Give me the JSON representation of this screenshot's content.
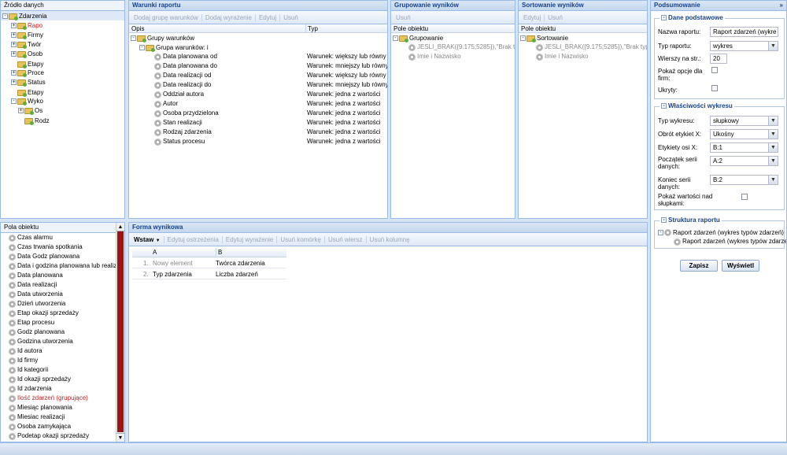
{
  "source_panel": {
    "title": "Źródło danych",
    "root": "Zdarzenia",
    "items": [
      {
        "label": "Rapo",
        "style": "red",
        "toggle": "+"
      },
      {
        "label": "Firmy",
        "style": "",
        "toggle": "+"
      },
      {
        "label": "Twór",
        "style": "",
        "toggle": "+"
      },
      {
        "label": "Osob",
        "style": "",
        "toggle": "+"
      },
      {
        "label": "Etapy",
        "style": "",
        "toggle": ""
      },
      {
        "label": "Proce",
        "style": "",
        "toggle": "+"
      },
      {
        "label": "Status",
        "style": "",
        "toggle": "+"
      },
      {
        "label": "Etapy",
        "style": "",
        "toggle": ""
      },
      {
        "label": "Wyko",
        "style": "",
        "toggle": "-"
      },
      {
        "label": "Os",
        "style": "",
        "toggle": "+",
        "sub": true
      },
      {
        "label": "Rodz",
        "style": "",
        "toggle": "",
        "sub": true
      }
    ]
  },
  "fields_panel": {
    "title": "Pola obiektu",
    "items": [
      {
        "label": "Czas alarmu",
        "red": false
      },
      {
        "label": "Czas trwania spotkania",
        "red": false
      },
      {
        "label": "Data Godz planowana",
        "red": false
      },
      {
        "label": "Data i godzina planowana lub realizacji",
        "red": false
      },
      {
        "label": "Data planowana",
        "red": false
      },
      {
        "label": "Data realizacji",
        "red": false
      },
      {
        "label": "Data utworzenia",
        "red": false
      },
      {
        "label": "Dzień utworzenia",
        "red": false
      },
      {
        "label": "Etap okazji sprzedaży",
        "red": false
      },
      {
        "label": "Etap procesu",
        "red": false
      },
      {
        "label": "Godz planowana",
        "red": false
      },
      {
        "label": "Godzina utworzenia",
        "red": false
      },
      {
        "label": "Id autora",
        "red": false
      },
      {
        "label": "Id firmy",
        "red": false
      },
      {
        "label": "Id kategorii",
        "red": false
      },
      {
        "label": "Id okazji sprzedaży",
        "red": false
      },
      {
        "label": "Id zdarzenia",
        "red": false
      },
      {
        "label": "Ilość zdarzeń (grupujące)",
        "red": true
      },
      {
        "label": "Miesiąc planowania",
        "red": false
      },
      {
        "label": "Miesiac realizacji",
        "red": false
      },
      {
        "label": "Osoba zamykająca",
        "red": false
      },
      {
        "label": "Podetap okazji sprzedaży",
        "red": false
      },
      {
        "label": "Powiązany proces",
        "red": false
      }
    ]
  },
  "conditions_panel": {
    "title": "Warunki raportu",
    "toolbar": [
      "Dodaj grupę warunków",
      "Dodaj wyrażenie",
      "Edytuj",
      "Usuń"
    ],
    "col_desc": "Opis",
    "col_type": "Typ",
    "group_root": "Grupy warunków",
    "group": "Grupa warunków: i",
    "rows": [
      {
        "desc": "Data planowana od",
        "type": "Warunek: większy lub równy"
      },
      {
        "desc": "Data planowana do",
        "type": "Warunek: mniejszy lub równy"
      },
      {
        "desc": "Data realizacji od",
        "type": "Warunek: większy lub równy"
      },
      {
        "desc": "Data realizacji do",
        "type": "Warunek: mniejszy lub równy"
      },
      {
        "desc": "Oddział autora",
        "type": "Warunek: jedna z wartości"
      },
      {
        "desc": "Autor",
        "type": "Warunek: jedna z wartości"
      },
      {
        "desc": "Osoba przydzielona",
        "type": "Warunek: jedna z wartości"
      },
      {
        "desc": "Stan realizacji",
        "type": "Warunek: jedna z wartości"
      },
      {
        "desc": "Rodzaj zdarzenia",
        "type": "Warunek: jedna z wartości"
      },
      {
        "desc": "Status procesu",
        "type": "Warunek: jedna z wartości"
      }
    ]
  },
  "grouping_panel": {
    "title": "Grupowanie wyników",
    "toolbar": [
      "Usuń"
    ],
    "col": "Pole obiektu",
    "root": "Grupowanie",
    "items": [
      "JESLI_BRAK({9.175;5285}),\"Brak typu",
      "Imie i Nazwisko"
    ]
  },
  "sorting_panel": {
    "title": "Sortowanie wyników",
    "toolbar": [
      "Edytuj",
      "Usuń"
    ],
    "col": "Pole obiektu",
    "root": "Sortowanie",
    "items": [
      "JESLI_BRAK({9.175;5285}),\"Brak typu",
      "Imie i Nazwisko"
    ]
  },
  "form_panel": {
    "title": "Forma wynikowa",
    "insert": "Wstaw",
    "toolbar": [
      "Edytuj ostrzeżenia",
      "Edytuj wyrażenie",
      "Usuń komórkę",
      "Usuń wiersz",
      "Usuń kolumnę"
    ],
    "col_a": "A",
    "col_b": "B",
    "rows": [
      {
        "n": "1.",
        "a": "Nowy element",
        "b": "Twórca zdarzenia",
        "a_grey": true
      },
      {
        "n": "2.",
        "a": "Typ zdarzenia",
        "b": "Liczba zdarzeń",
        "a_grey": false
      }
    ]
  },
  "summary_panel": {
    "title": "Podsumowanie",
    "collapse_icon": "»",
    "basic": {
      "legend": "Dane podstawowe",
      "name_label": "Nazwa raportu:",
      "name_value": "Raport zdarzeń (wykre",
      "type_label": "Typ raportu:",
      "type_value": "wykres",
      "rows_label": "Wierszy na str.:",
      "rows_value": "20",
      "show_options_label": "Pokaż opcje dla firm:",
      "hidden_label": "Ukryty:"
    },
    "chart": {
      "legend": "Właściwości wykresu",
      "chart_type_label": "Typ wykresu:",
      "chart_type_value": "słupkowy",
      "rotation_label": "Obrót etykiet X:",
      "rotation_value": "Ukośny",
      "xlabels_label": "Etykiety osi X:",
      "xlabels_value": "B:1",
      "start_label": "Początek serii danych:",
      "start_value": "A:2",
      "end_label": "Koniec serii danych:",
      "end_value": "B:2",
      "show_values_label": "Pokaż wartości nad słupkami:"
    },
    "structure": {
      "legend": "Struktura raportu",
      "root": "Raport zdarzeń (wykres typów zdarzeń)",
      "child": "Raport zdarzeń (wykres typów zdarzeń) II"
    },
    "save": "Zapisz",
    "show": "Wyświetl"
  }
}
